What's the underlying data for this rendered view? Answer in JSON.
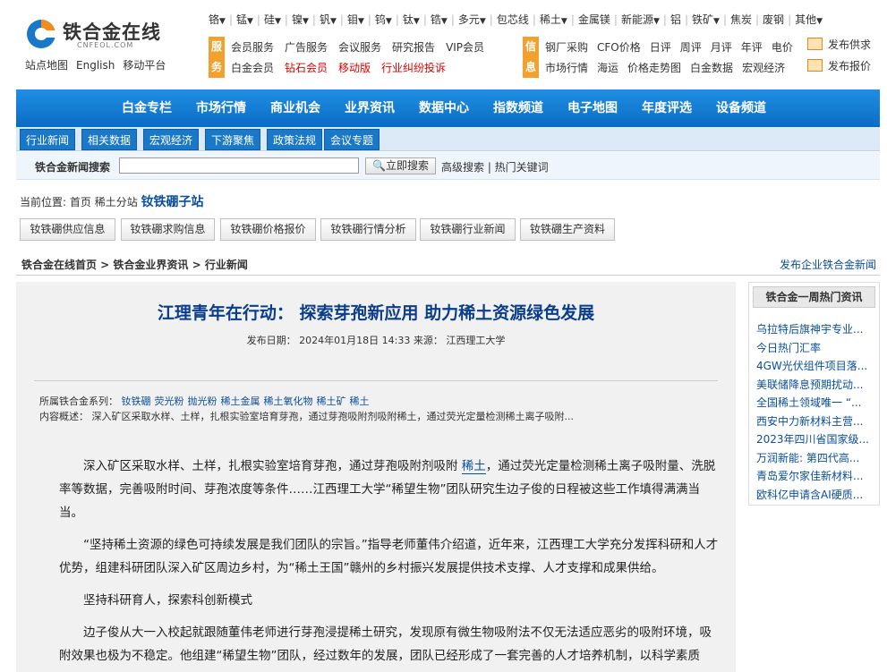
{
  "logo": {
    "text": "铁合金在线",
    "sub": "CNFEOL.COM"
  },
  "toplinks": [
    "站点地图",
    "English",
    "移动平台"
  ],
  "metals": [
    "铬",
    "锰",
    "硅",
    "镍",
    "钒",
    "钼",
    "钨",
    "钛",
    "锆",
    "多元",
    "包芯线",
    "稀土",
    "金属镁",
    "新能源",
    "铝",
    "铁矿",
    "焦炭",
    "废钢",
    "其他"
  ],
  "metals_dropdown": [
    true,
    true,
    true,
    true,
    true,
    true,
    true,
    true,
    true,
    true,
    false,
    true,
    false,
    true,
    false,
    true,
    false,
    false,
    true
  ],
  "service": {
    "badge1": "服",
    "badge2": "务",
    "row1": [
      "会员服务",
      "广告服务",
      "会议服务",
      "研究报告",
      "VIP会员"
    ],
    "row2": [
      "白金会员",
      "钻石会员",
      "移动版",
      "行业纠纷投诉"
    ]
  },
  "info": {
    "badge1": "信",
    "badge2": "息",
    "row1": [
      "钢厂采购",
      "CFO价格",
      "日评",
      "周评",
      "月评",
      "年评",
      "电价"
    ],
    "row2": [
      "市场行情",
      "海运",
      "价格走势图",
      "白金数据",
      "宏观经济"
    ]
  },
  "publish": {
    "supply": "发布供求",
    "quote": "发布报价"
  },
  "nav": [
    "白金专栏",
    "市场行情",
    "商业机会",
    "业界资讯",
    "数据中心",
    "指数频道",
    "电子地图",
    "年度评选",
    "设备频道"
  ],
  "subnav": [
    "行业新闻",
    "相关数据",
    "宏观经济",
    "下游聚焦",
    "政策法规",
    "会议专题"
  ],
  "search": {
    "label": "铁合金新闻搜索",
    "value": "",
    "button": "立即搜索",
    "advanced": "高级搜索 | 热门关键词"
  },
  "location": {
    "prefix": "当前位置:",
    "home": "首页",
    "branch": "稀土分站",
    "station": "钕铁硼子站"
  },
  "station_buttons": [
    "钕铁硼供应信息",
    "钕铁硼求购信息",
    "钕铁硼价格报价",
    "钕铁硼行情分析",
    "钕铁硼行业新闻",
    "钕铁硼生产资料"
  ],
  "breadcrumb": {
    "path": "铁合金在线首页 > 铁合金业界资讯 > 行业新闻",
    "publish": "发布企业铁合金新闻"
  },
  "article": {
    "title": "江理青年在行动： 探索芽孢新应用 助力稀土资源绿色发展",
    "meta": "发布日期： 2024年01月18日 14:33 来源： 江西理工大学",
    "cat_label": "所属铁合金系列：",
    "tags": [
      "钕铁硼",
      "荧光粉",
      "抛光粉",
      "稀土金属",
      "稀土氧化物",
      "稀土矿",
      "稀土"
    ],
    "summary": "内容概述：  深入矿区采取水样、土样，扎根实验室培育芽孢，通过芽孢吸附剂吸附稀土，通过荧光定量检测稀土离子吸附...",
    "p1a": "深入矿区采取水样、土样，扎根实验室培育芽孢，通过芽孢吸附剂吸附",
    "p1kw": "稀土",
    "p1b": "，通过荧光定量检测稀土离子吸附量、洗脱率等数据，完善吸附时间、芽孢浓度等条件……江西理工大学“稀望生物”团队研究生边子俊的日程被这些工作填得满满当当。",
    "p2": "“坚持稀土资源的绿色可持续发展是我们团队的宗旨。”指导老师董伟介绍道，近年来，江西理工大学充分发挥科研和人才优势，组建科研团队深入矿区周边乡村，为“稀土王国”赣州的乡村振兴发展提供技术支撑、人才支撑和成果供给。",
    "p3": "坚持科研育人，探索科创新模式",
    "p4": "边子俊从大一入校起就跟随董伟老师进行芽孢浸提稀土研究，发现原有微生物吸附法不仅无法适应恶劣的吸附环境，吸附效果也极为不稳定。他组建“稀望生物”团队，经过数年的发展，团队已经形成了一套完善的人才培养机制，以科学素质"
  },
  "sidebar": {
    "title": "铁合金一周热门资讯",
    "items": [
      "乌拉特后旗神宇专业...",
      "今日热门汇率",
      "4GW光伏组件项目落...",
      "美联储降息预期扰动...",
      "全国稀土领域唯一 “...",
      "西安中力新材料主营...",
      "2023年四川省国家级...",
      "万润新能: 第四代高...",
      "青岛爱尔家佳新材料...",
      "欧科亿申请含AI硬质..."
    ]
  }
}
